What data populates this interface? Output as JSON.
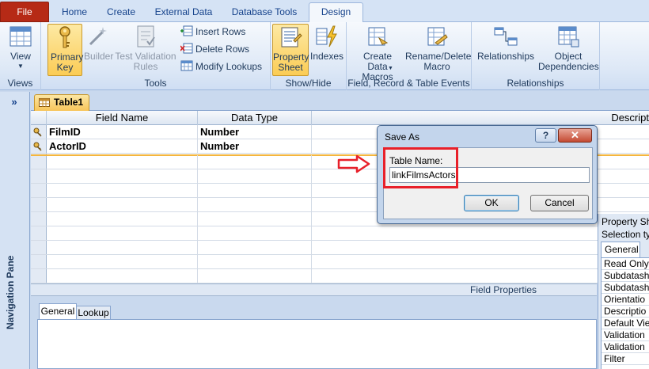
{
  "ribbon_tabs": {
    "file": "File",
    "home": "Home",
    "create": "Create",
    "external_data": "External Data",
    "database_tools": "Database Tools",
    "design": "Design"
  },
  "ribbon": {
    "views": {
      "view_label": "View",
      "group_label": "Views"
    },
    "tools": {
      "primary_key": "Primary Key",
      "builder": "Builder",
      "test_validation": "Test Validation Rules",
      "insert_rows": "Insert Rows",
      "delete_rows": "Delete Rows",
      "modify_lookups": "Modify Lookups",
      "group_label": "Tools"
    },
    "show_hide": {
      "property_sheet": "Property Sheet",
      "indexes": "Indexes",
      "group_label": "Show/Hide"
    },
    "events": {
      "create_data_macros": "Create Data Macros",
      "rename_delete_macro": "Rename/Delete Macro",
      "group_label": "Field, Record & Table Events"
    },
    "relationships": {
      "relationships": "Relationships",
      "object_dependencies": "Object Dependencies",
      "group_label": "Relationships"
    }
  },
  "nav": {
    "toggle": "»",
    "label": "Navigation Pane"
  },
  "document_tab": {
    "label": "Table1"
  },
  "grid": {
    "headers": {
      "field_name": "Field Name",
      "data_type": "Data Type",
      "description": "Descript"
    },
    "rows": [
      {
        "field": "FilmID",
        "type": "Number"
      },
      {
        "field": "ActorID",
        "type": "Number"
      }
    ]
  },
  "field_properties": {
    "title": "Field Properties",
    "general_tab": "General",
    "lookup_tab": "Lookup"
  },
  "property_sheet": {
    "title": "Property Sh",
    "selection": "Selection ty",
    "tab": "General",
    "rows": [
      "Read Only",
      "Subdatash",
      "Subdatash",
      "Orientatio",
      "Descriptio",
      "Default Vie",
      "Validation",
      "Validation",
      "Filter"
    ]
  },
  "dialog": {
    "title": "Save As",
    "help": "?",
    "close": "✕",
    "label": "Table Name:",
    "value": "linkFilmsActors",
    "ok": "OK",
    "cancel": "Cancel"
  },
  "colors": {
    "file_tab": "#b62a16",
    "annotation": "#e8202a",
    "selected_row_line": "#f4b63f",
    "ribbon_active": "#fbcc55"
  }
}
